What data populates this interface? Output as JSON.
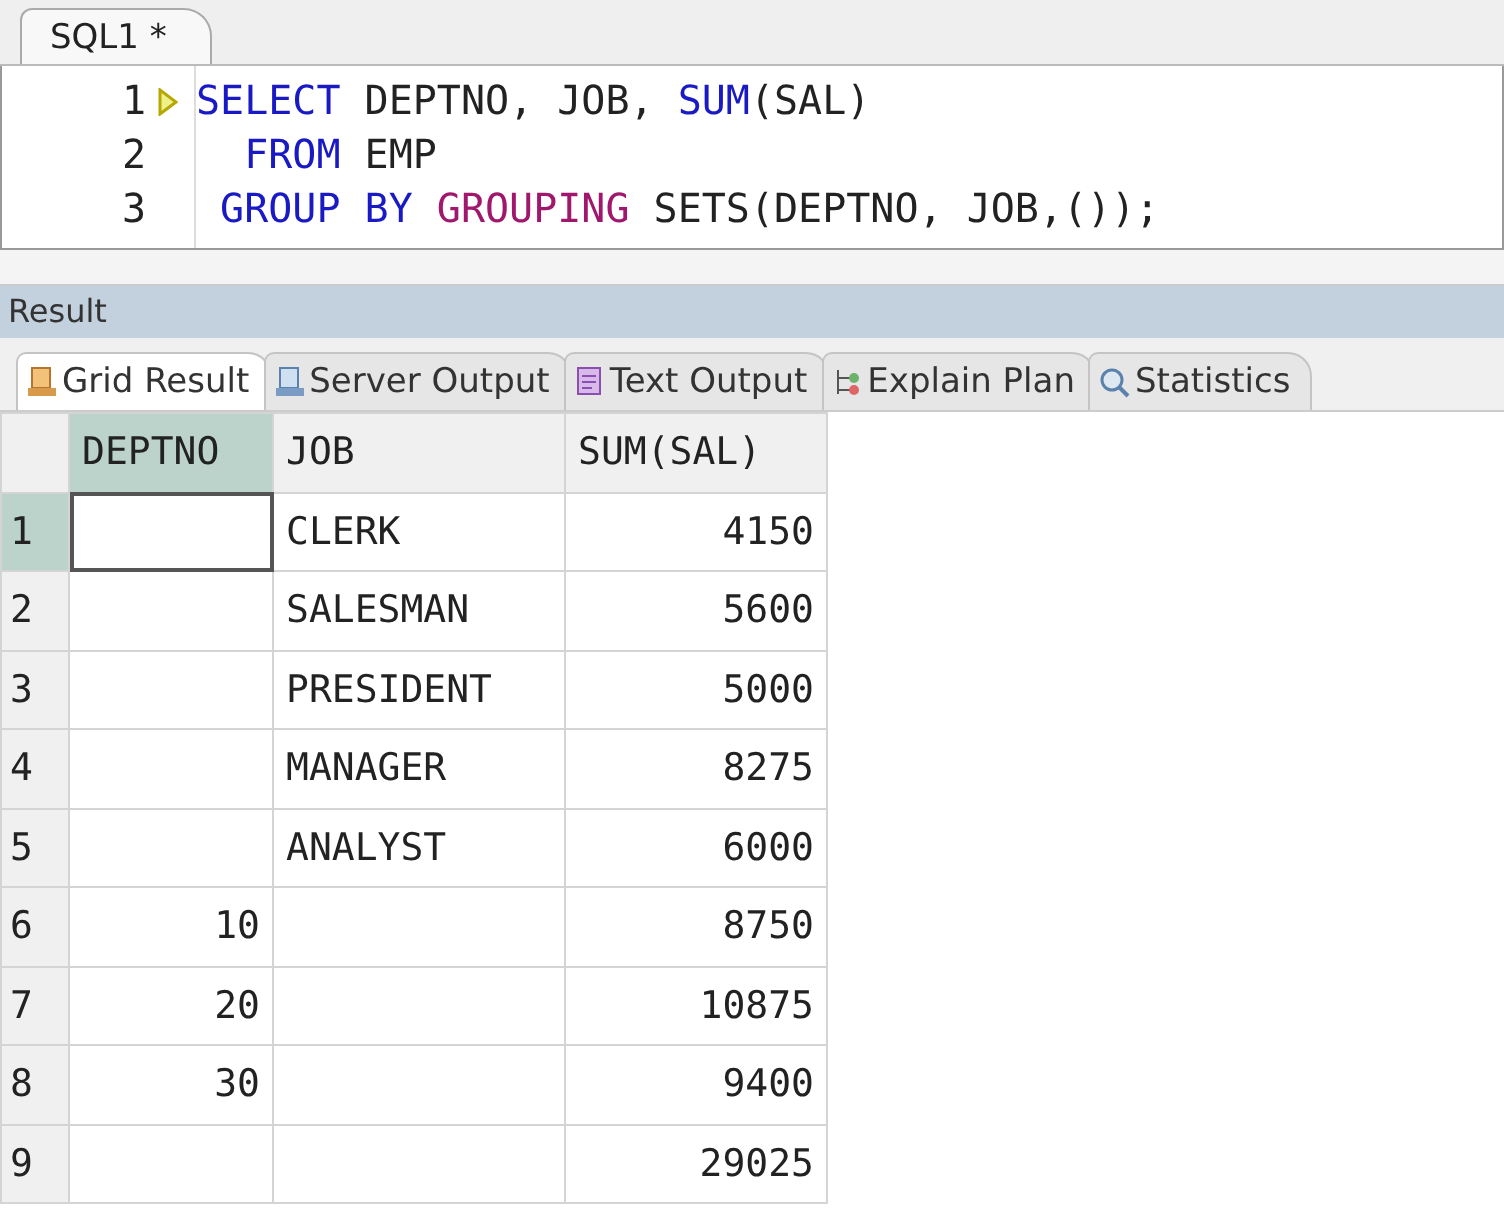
{
  "editor_tabs": [
    {
      "label": "SQL1 *",
      "selected": true
    }
  ],
  "code_lines": [
    {
      "number": "1",
      "current": true,
      "tokens": [
        {
          "text": "SELECT",
          "kind": "keyword"
        },
        {
          "text": " DEPTNO, JOB, ",
          "kind": "plain"
        },
        {
          "text": "SUM",
          "kind": "keyword"
        },
        {
          "text": "(SAL)",
          "kind": "plain"
        }
      ]
    },
    {
      "number": "2",
      "current": false,
      "tokens": [
        {
          "text": "  FROM",
          "kind": "keyword"
        },
        {
          "text": " EMP",
          "kind": "plain"
        }
      ]
    },
    {
      "number": "3",
      "current": false,
      "tokens": [
        {
          "text": " GROUP BY ",
          "kind": "keyword"
        },
        {
          "text": "GROUPING",
          "kind": "function"
        },
        {
          "text": " SETS(DEPTNO, JOB,());",
          "kind": "plain"
        }
      ]
    }
  ],
  "result_panel": {
    "title": "Result"
  },
  "result_tabs": [
    {
      "label": "Grid Result",
      "selected": true
    },
    {
      "label": "Server Output",
      "selected": false
    },
    {
      "label": "Text Output",
      "selected": false
    },
    {
      "label": "Explain Plan",
      "selected": false
    },
    {
      "label": "Statistics",
      "selected": false
    }
  ],
  "grid": {
    "columns": [
      {
        "name": "DEPTNO",
        "selected": true
      },
      {
        "name": "JOB",
        "selected": false
      },
      {
        "name": "SUM(SAL)",
        "selected": false
      }
    ],
    "rows": [
      {
        "number": "1",
        "selected": true,
        "cells": [
          "",
          "CLERK",
          "4150"
        ]
      },
      {
        "number": "2",
        "selected": false,
        "cells": [
          "",
          "SALESMAN",
          "5600"
        ]
      },
      {
        "number": "3",
        "selected": false,
        "cells": [
          "",
          "PRESIDENT",
          "5000"
        ]
      },
      {
        "number": "4",
        "selected": false,
        "cells": [
          "",
          "MANAGER",
          "8275"
        ]
      },
      {
        "number": "5",
        "selected": false,
        "cells": [
          "",
          "ANALYST",
          "6000"
        ]
      },
      {
        "number": "6",
        "selected": false,
        "cells": [
          "10",
          "",
          "8750"
        ]
      },
      {
        "number": "7",
        "selected": false,
        "cells": [
          "20",
          "",
          "10875"
        ]
      },
      {
        "number": "8",
        "selected": false,
        "cells": [
          "30",
          "",
          "9400"
        ]
      },
      {
        "number": "9",
        "selected": false,
        "cells": [
          "",
          "",
          "29025"
        ]
      }
    ]
  }
}
